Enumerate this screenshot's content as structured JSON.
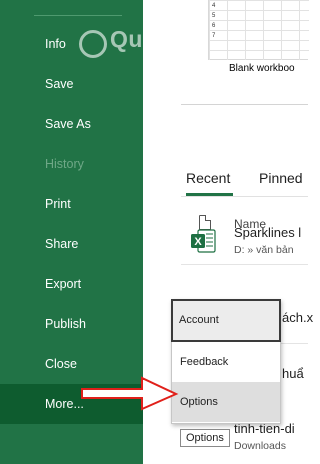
{
  "sidebar": {
    "items": [
      {
        "label": "Info",
        "state": "normal"
      },
      {
        "label": "Save",
        "state": "normal"
      },
      {
        "label": "Save As",
        "state": "normal"
      },
      {
        "label": "History",
        "state": "disabled"
      },
      {
        "label": "Print",
        "state": "normal"
      },
      {
        "label": "Share",
        "state": "normal"
      },
      {
        "label": "Export",
        "state": "normal"
      },
      {
        "label": "Publish",
        "state": "normal"
      },
      {
        "label": "Close",
        "state": "normal"
      },
      {
        "label": "More...",
        "state": "active"
      }
    ]
  },
  "template": {
    "caption": "Blank workboo",
    "row_numbers": [
      "4",
      "5",
      "6",
      "7"
    ]
  },
  "tabs": [
    {
      "label": "Recent",
      "selected": true
    },
    {
      "label": "Pinned",
      "selected": false
    }
  ],
  "list_header": {
    "name_label": "Name",
    "icon": "file-icon"
  },
  "files": [
    {
      "name": "Sparklines l",
      "path": "D: » văn bản",
      "icon": "excel-icon"
    },
    {
      "name": "ách.x",
      "path": ""
    },
    {
      "name": "huẩ",
      "path": ""
    },
    {
      "name": "tinh-tien-di",
      "path": "Downloads"
    }
  ],
  "more_menu": {
    "items": [
      {
        "label": "Account",
        "state": "outlined"
      },
      {
        "label": "Feedback",
        "state": "normal"
      },
      {
        "label": "Options",
        "state": "hover"
      }
    ]
  },
  "tooltip": "Options",
  "watermark": "Quantrimang",
  "colors": {
    "sidebar_bg": "#217346",
    "sidebar_active": "#0e5c2f",
    "accent": "#217346",
    "arrow": "#e0201a"
  }
}
